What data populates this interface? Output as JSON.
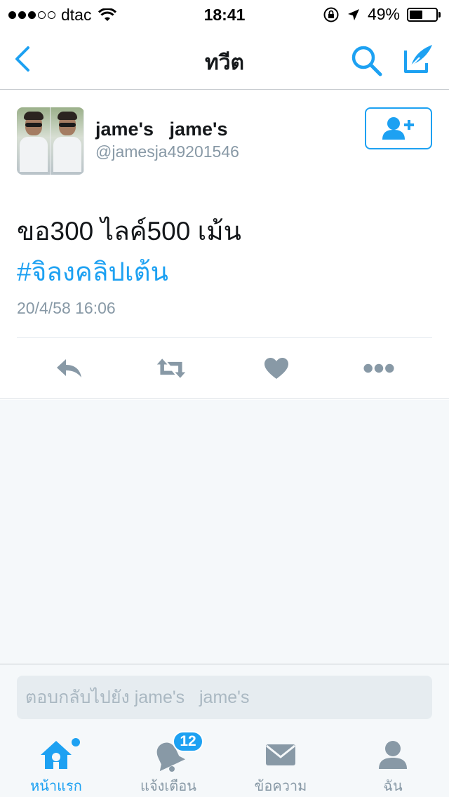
{
  "status_bar": {
    "carrier": "dtac",
    "time": "18:41",
    "battery_percent": "49%",
    "battery_level": 0.49,
    "signal_bars_filled": 3,
    "signal_bars_total": 5
  },
  "nav": {
    "title": "ทวีต",
    "back_icon": "chevron-left-icon",
    "search_icon": "search-icon",
    "compose_icon": "compose-tweet-icon"
  },
  "tweet": {
    "name": "jame's   jame's",
    "handle": "@jamesja49201546",
    "text": "ขอ300 ไลค์500 เม้น",
    "hashtag": "#จิลงคลิปเต้น",
    "timestamp": "20/4/58 16:06",
    "follow_icon": "add-user-icon",
    "actions": [
      "reply-icon",
      "retweet-icon",
      "like-icon",
      "more-icon"
    ]
  },
  "reply": {
    "placeholder": "ตอบกลับไปยัง jame's   jame's"
  },
  "tabs": [
    {
      "label": "หน้าแรก",
      "icon": "home-icon",
      "active": true,
      "new_dot": true
    },
    {
      "label": "แจ้งเตือน",
      "icon": "notifications-icon",
      "badge": "12"
    },
    {
      "label": "ข้อความ",
      "icon": "messages-icon"
    },
    {
      "label": "ฉัน",
      "icon": "profile-icon"
    }
  ],
  "colors": {
    "accent": "#1da1f2",
    "muted": "#8899a6",
    "background": "#f5f8fa"
  }
}
